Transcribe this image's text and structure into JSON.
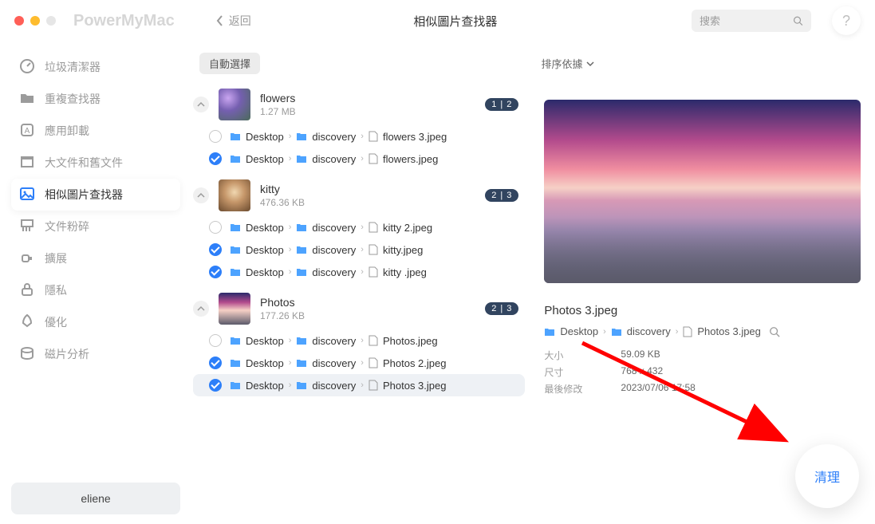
{
  "app": {
    "brand": "PowerMyMac",
    "back_label": "返回",
    "page_title": "相似圖片查找器",
    "search_placeholder": "搜索",
    "help_glyph": "?"
  },
  "sidebar": {
    "items": [
      {
        "id": "trash-cleaner",
        "label": "垃圾清潔器",
        "icon": "gauge"
      },
      {
        "id": "dup-finder",
        "label": "重複查找器",
        "icon": "folder"
      },
      {
        "id": "uninstaller",
        "label": "應用卸載",
        "icon": "app-box"
      },
      {
        "id": "large-old",
        "label": "大文件和舊文件",
        "icon": "archive"
      },
      {
        "id": "similar-images",
        "label": "相似圖片查找器",
        "icon": "image",
        "active": true
      },
      {
        "id": "shredder",
        "label": "文件粉碎",
        "icon": "shred"
      },
      {
        "id": "extensions",
        "label": "擴展",
        "icon": "plug"
      },
      {
        "id": "privacy",
        "label": "隱私",
        "icon": "lock"
      },
      {
        "id": "optimize",
        "label": "優化",
        "icon": "rocket"
      },
      {
        "id": "disk",
        "label": "磁片分析",
        "icon": "disk"
      }
    ],
    "user_label": "eliene"
  },
  "toolbar": {
    "auto_select_label": "自動選擇",
    "sort_label": "排序依據"
  },
  "path_labels": {
    "desktop": "Desktop",
    "discovery": "discovery"
  },
  "groups": [
    {
      "name": "flowers",
      "size": "1.27 MB",
      "badge": "1 | 2",
      "thumb_class": "flowers",
      "files": [
        {
          "checked": false,
          "name": "flowers 3.jpeg"
        },
        {
          "checked": true,
          "name": "flowers.jpeg"
        }
      ]
    },
    {
      "name": "kitty",
      "size": "476.36 KB",
      "badge": "2 | 3",
      "thumb_class": "kitty",
      "files": [
        {
          "checked": false,
          "name": "kitty 2.jpeg"
        },
        {
          "checked": true,
          "name": "kitty.jpeg"
        },
        {
          "checked": true,
          "name": "kitty .jpeg"
        }
      ]
    },
    {
      "name": "Photos",
      "size": "177.26 KB",
      "badge": "2 | 3",
      "thumb_class": "photos",
      "files": [
        {
          "checked": false,
          "name": "Photos.jpeg"
        },
        {
          "checked": true,
          "name": "Photos 2.jpeg"
        },
        {
          "checked": true,
          "name": "Photos 3.jpeg",
          "selected": true
        }
      ]
    }
  ],
  "preview": {
    "filename": "Photos 3.jpeg",
    "path_segments": [
      "Desktop",
      "discovery",
      "Photos 3.jpeg"
    ],
    "meta": {
      "size_label": "大小",
      "size_value": "59.09 KB",
      "dim_label": "尺寸",
      "dim_value": "768 x 432",
      "mod_label": "最後修改",
      "mod_value": "2023/07/06 17:58"
    }
  },
  "clean_label": "清理"
}
